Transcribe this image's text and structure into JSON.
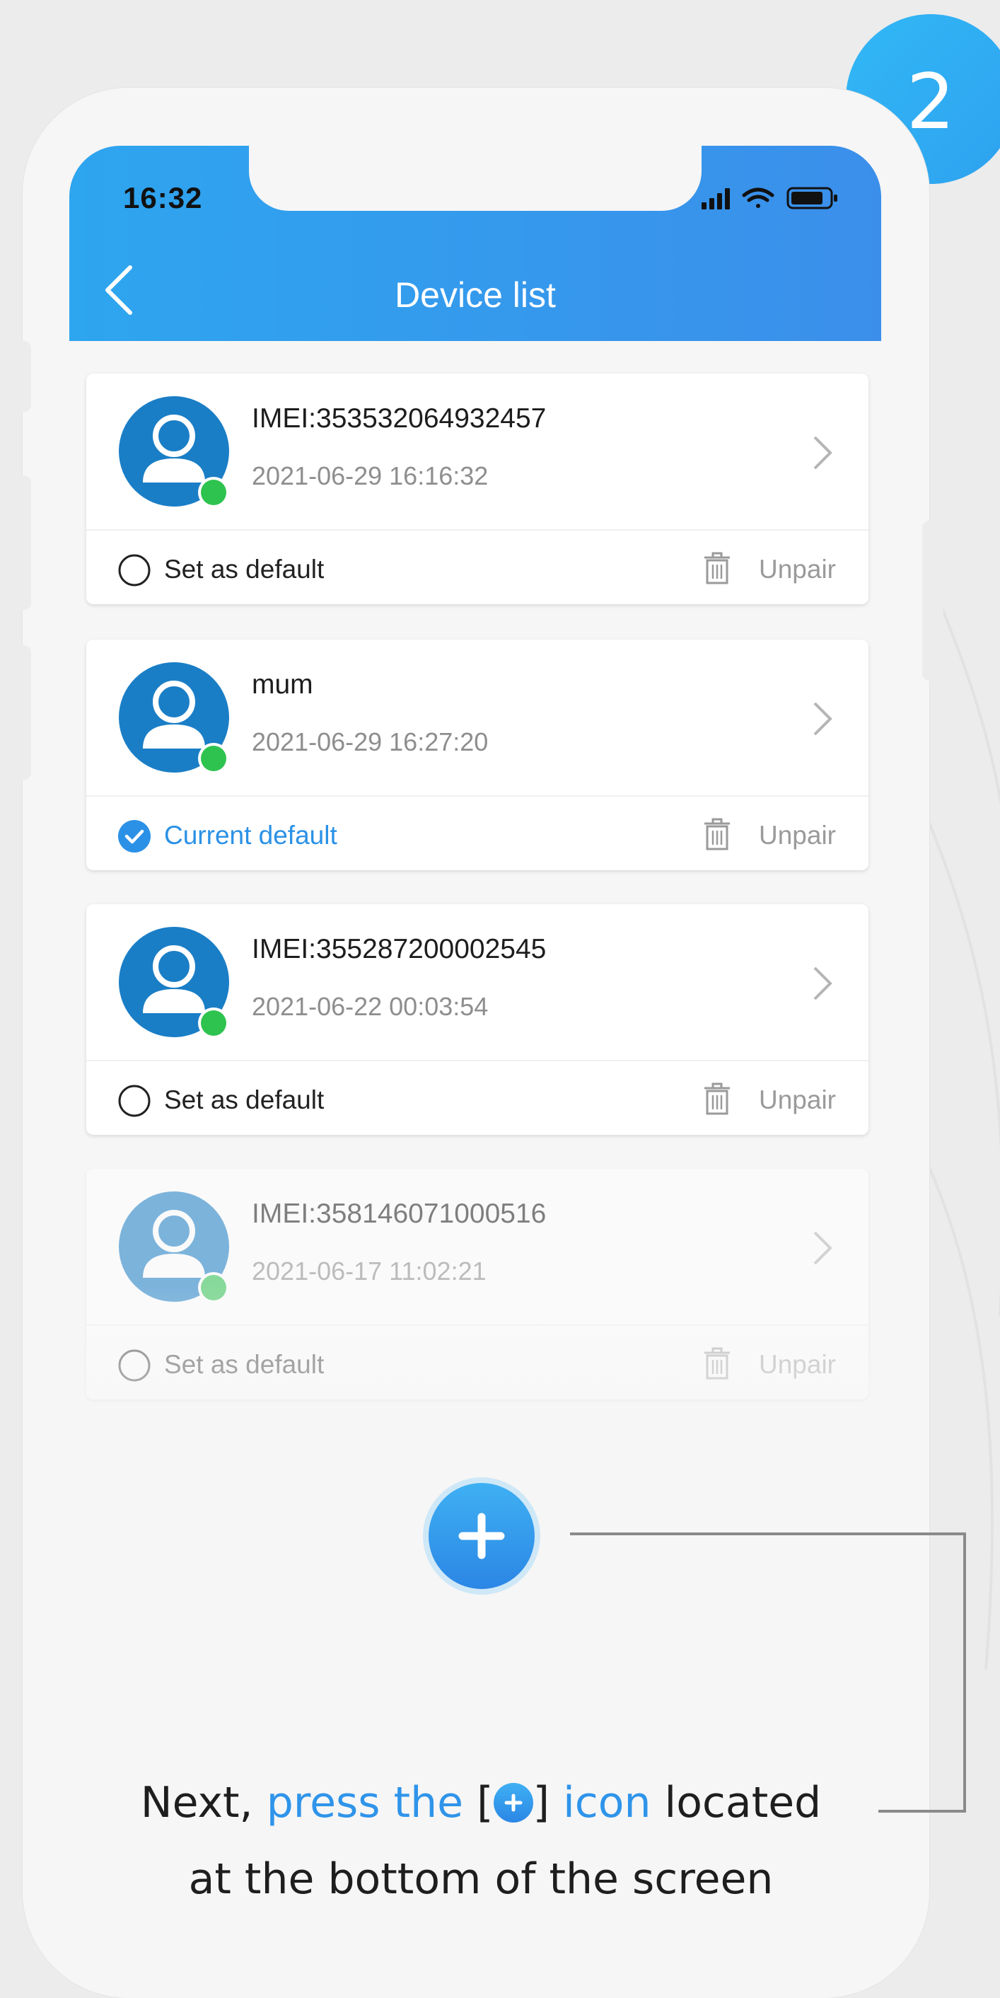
{
  "step_badge": "2",
  "status_bar": {
    "time": "16:32"
  },
  "header": {
    "title": "Device list"
  },
  "devices": [
    {
      "name": "IMEI:353532064932457",
      "time": "2021-06-29 16:16:32",
      "default_label": "Set as default",
      "is_default": false,
      "unpair_label": "Unpair"
    },
    {
      "name": "mum",
      "time": "2021-06-29 16:27:20",
      "default_label": "Current default",
      "is_default": true,
      "unpair_label": "Unpair"
    },
    {
      "name": "IMEI:355287200002545",
      "time": "2021-06-22 00:03:54",
      "default_label": "Set as default",
      "is_default": false,
      "unpair_label": "Unpair"
    },
    {
      "name": "IMEI:358146071000516",
      "time": "2021-06-17 11:02:21",
      "default_label": "Set as default",
      "is_default": false,
      "unpair_label": "Unpair"
    }
  ],
  "instruction": {
    "part1": "Next, ",
    "part2": "press the",
    "part3": " [",
    "part4": "] ",
    "part5": "icon",
    "part6": " located",
    "line2": "at the bottom of the screen"
  },
  "colors": {
    "accent": "#2f94ea",
    "header_start": "#2ea5ef",
    "header_end": "#3b8fea",
    "online": "#2ec34f"
  },
  "icons": {
    "back": "chevron-left-icon",
    "add": "plus-circle-icon",
    "trash": "trash-icon",
    "chevron": "chevron-right-icon"
  }
}
